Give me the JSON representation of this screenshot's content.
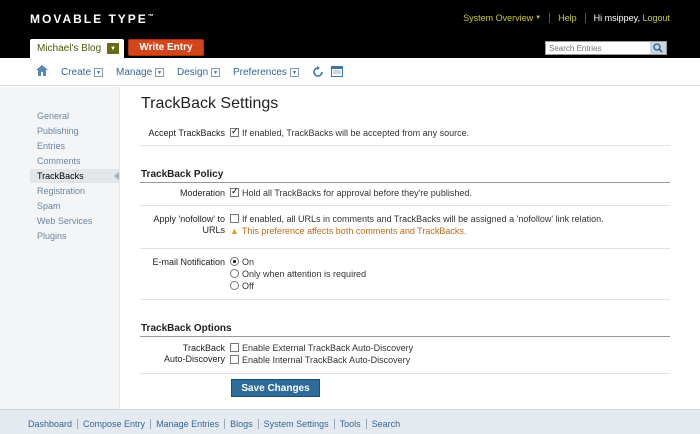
{
  "header": {
    "logo_text": "MOVABLE TYPE",
    "logo_tm": "™",
    "system_overview": "System Overview",
    "help": "Help",
    "greeting": "Hi msippey,",
    "logout": "Logout",
    "blog_name": "Michael's Blog",
    "write_entry": "Write Entry",
    "search_placeholder": "Search Entries"
  },
  "nav": {
    "items": [
      "Create",
      "Manage",
      "Design",
      "Preferences"
    ]
  },
  "sidebar": {
    "items": [
      "General",
      "Publishing",
      "Entries",
      "Comments",
      "TrackBacks",
      "Registration",
      "Spam",
      "Web Services",
      "Plugins"
    ],
    "active": "TrackBacks"
  },
  "main": {
    "title": "TrackBack Settings",
    "accept": {
      "label": "Accept TrackBacks",
      "text": "If enabled, TrackBacks will be accepted from any source.",
      "checked": true
    },
    "policy_title": "TrackBack Policy",
    "moderation": {
      "label": "Moderation",
      "text": "Hold all TrackBacks for approval before they're published.",
      "checked": true
    },
    "nofollow": {
      "label_line1": "Apply 'nofollow' to",
      "label_line2": "URLs",
      "text": "If enabled, all URLs in comments and TrackBacks will be assigned a 'nofollow' link relation.",
      "warning": "This preference affects both comments and TrackBacks.",
      "checked": false
    },
    "email": {
      "label": "E-mail Notification",
      "options": [
        "On",
        "Only when attention is required",
        "Off"
      ],
      "selected": "On"
    },
    "options_title": "TrackBack Options",
    "autodiscovery": {
      "label_line1": "TrackBack",
      "label_line2": "Auto-Discovery",
      "external": "Enable External TrackBack Auto-Discovery",
      "internal": "Enable Internal TrackBack Auto-Discovery"
    },
    "save_label": "Save Changes"
  },
  "footer": {
    "links": [
      "Dashboard",
      "Compose Entry",
      "Manage Entries",
      "Blogs",
      "System Settings",
      "Tools",
      "Search"
    ]
  },
  "colors": {
    "header_bg": "#000000",
    "accent_orange": "#d5451b",
    "link_blue": "#336699",
    "save_blue": "#2d6b99",
    "warning": "#c06a1a"
  }
}
